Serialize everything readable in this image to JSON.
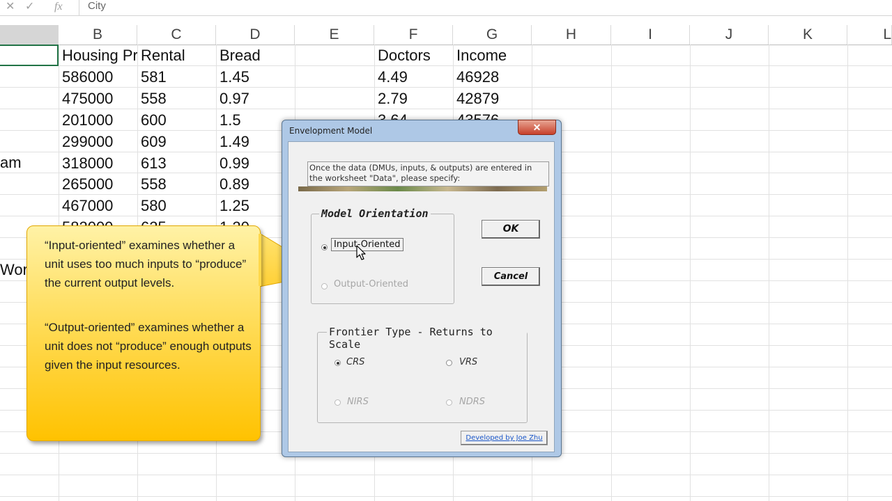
{
  "formula_bar": {
    "cancel_glyph": "✕",
    "enter_glyph": "✓",
    "fx_glyph": "fx",
    "content": "City"
  },
  "columns": [
    "B",
    "C",
    "D",
    "E",
    "F",
    "G",
    "H",
    "I",
    "J",
    "K",
    "L"
  ],
  "sheet": {
    "row_headers_visible": false,
    "col_a_partial": [
      "",
      "",
      "",
      "",
      "am",
      "",
      "",
      "",
      "",
      "Wor"
    ],
    "header_row": [
      "Housing Pr",
      "Rental",
      "Bread",
      "",
      "Doctors",
      "Income"
    ],
    "rows": [
      [
        "586000",
        "581",
        "1.45",
        "",
        "4.49",
        "46928"
      ],
      [
        "475000",
        "558",
        "0.97",
        "",
        "2.79",
        "42879"
      ],
      [
        "201000",
        "600",
        "1.5",
        "",
        "3.64",
        "43576"
      ],
      [
        "299000",
        "609",
        "1.49",
        "",
        "",
        ""
      ],
      [
        "318000",
        "613",
        "0.99",
        "",
        "",
        ""
      ],
      [
        "265000",
        "558",
        "0.89",
        "",
        "",
        ""
      ],
      [
        "467000",
        "580",
        "1.25",
        "",
        "",
        ""
      ],
      [
        "582000",
        "625",
        "1.20",
        "",
        "",
        ""
      ]
    ]
  },
  "callout": {
    "paragraph1": "“Input-oriented” examines whether a unit uses too much inputs to “produce” the current output levels.",
    "paragraph2": "“Output-oriented” examines whether a unit does not “produce” enough outputs given the input resources."
  },
  "dialog": {
    "title": "Envelopment Model",
    "close_glyph": "✕",
    "info_text": "Once the data (DMUs, inputs, & outputs) are entered in the worksheet \"Data\", please specify:",
    "orientation": {
      "label": "Model Orientation",
      "options": [
        {
          "label": "Input-Oriented",
          "selected": true
        },
        {
          "label": "Output-Oriented",
          "selected": false
        }
      ]
    },
    "frontier": {
      "label": "Frontier Type - Returns to Scale",
      "options": [
        {
          "label": "CRS",
          "selected": true
        },
        {
          "label": "VRS",
          "selected": false
        },
        {
          "label": "NIRS",
          "selected": false
        },
        {
          "label": "NDRS",
          "selected": false
        }
      ]
    },
    "ok_label": "OK",
    "cancel_label": "Cancel",
    "developer_label": "Developed by Joe Zhu"
  },
  "colors": {
    "selection_border": "#217346",
    "callout_yellow": "#ffc200",
    "dialog_frame": "#aec8e6",
    "link_blue": "#1a56c8"
  }
}
